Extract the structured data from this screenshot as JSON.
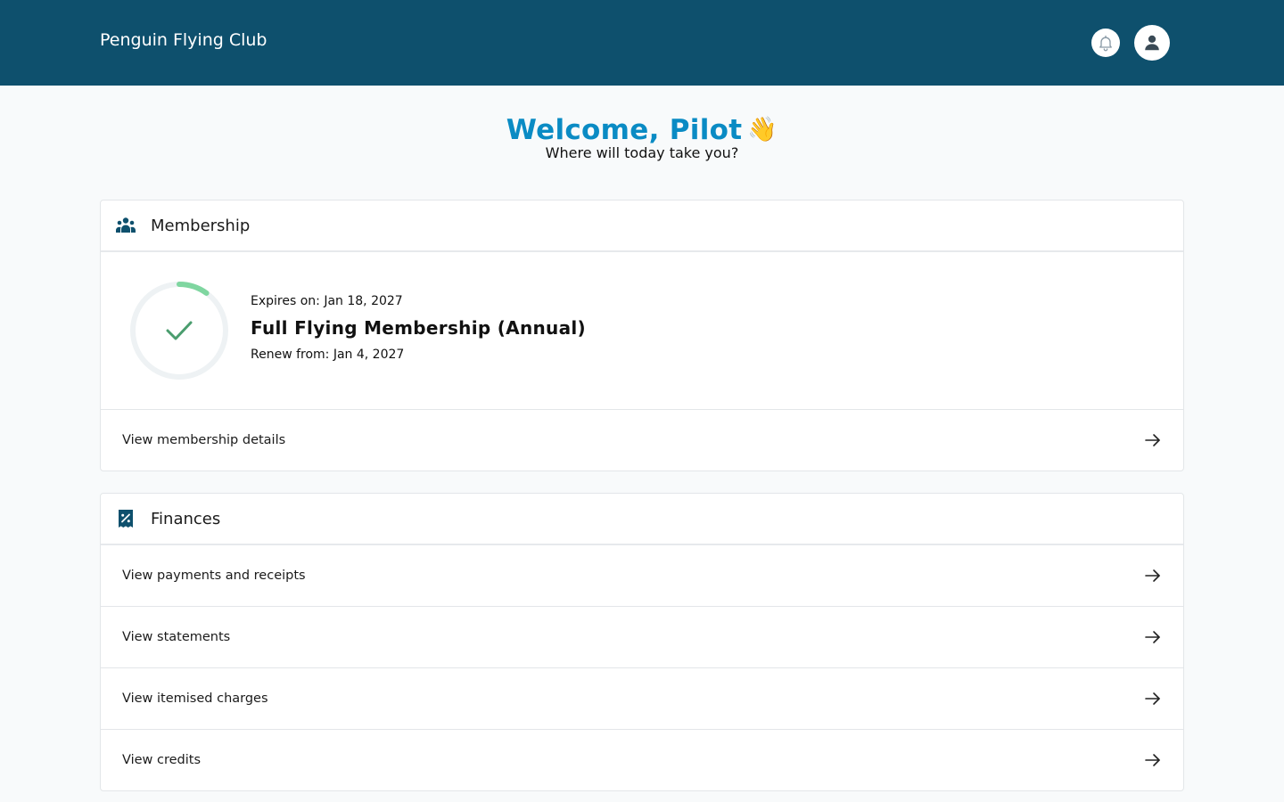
{
  "header": {
    "brand": "Penguin Flying Club",
    "bell_icon": "bell-icon",
    "avatar_icon": "user-icon"
  },
  "welcome": {
    "title": "Welcome, Pilot",
    "emoji": "👋",
    "subtitle": "Where will today take you?"
  },
  "membership": {
    "title": "Membership",
    "icon": "people-group-icon",
    "expires_label": "Expires on: Jan 18, 2027",
    "plan_name": "Full Flying Membership (Annual)",
    "renew_label": "Renew from: Jan 4, 2027",
    "status_icon": "check-icon",
    "progress_fraction": 0.1,
    "progress_color": "#7fd6a0",
    "track_color": "#eef2f4",
    "check_color": "#4a9d6e",
    "details_link": "View membership details"
  },
  "finances": {
    "title": "Finances",
    "icon": "receipt-percent-icon",
    "links": [
      "View payments and receipts",
      "View statements",
      "View itemised charges",
      "View credits"
    ]
  },
  "colors": {
    "header_bg": "#0e506d",
    "accent": "#0a8bc4",
    "icon": "#0e506d"
  }
}
